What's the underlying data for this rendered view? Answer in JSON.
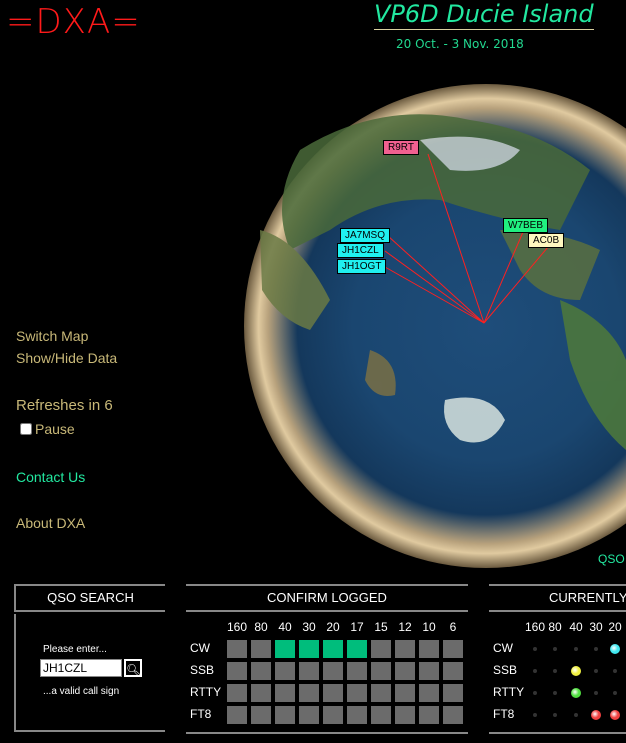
{
  "header": {
    "logo": "=DXA=",
    "title": "VP6D Ducie Island",
    "dates": "20 Oct. - 3 Nov. 2018"
  },
  "sidebar": {
    "switch_map": "Switch Map",
    "show_hide": "Show/Hide Data",
    "refresh": "Refreshes in 6",
    "pause": "Pause",
    "pause_checked": false,
    "contact": "Contact Us",
    "about": "About DXA"
  },
  "map": {
    "corner_text": "QSO",
    "spots": [
      {
        "call": "R9RT",
        "color": "#f06090"
      },
      {
        "call": "W7BEB",
        "color": "#20f080"
      },
      {
        "call": "AC0B",
        "color": "#fff8c0"
      },
      {
        "call": "JA7MSQ",
        "color": "#20f0f0"
      },
      {
        "call": "JH1CZL",
        "color": "#20f0f0"
      },
      {
        "call": "JH1OGT",
        "color": "#20f0f0"
      }
    ]
  },
  "search": {
    "title": "QSO SEARCH",
    "prompt": "Please enter...",
    "value": "JH1CZL",
    "hint": "...a valid call sign"
  },
  "confirm": {
    "title": "CONFIRM  LOGGED",
    "bands": [
      "160",
      "80",
      "40",
      "30",
      "20",
      "17",
      "15",
      "12",
      "10",
      "6"
    ],
    "modes": [
      "CW",
      "SSB",
      "RTTY",
      "FT8"
    ],
    "logged": [
      [
        0,
        0,
        1,
        1,
        1,
        1,
        0,
        0,
        0,
        0
      ],
      [
        0,
        0,
        0,
        0,
        0,
        0,
        0,
        0,
        0,
        0
      ],
      [
        0,
        0,
        0,
        0,
        0,
        0,
        0,
        0,
        0,
        0
      ],
      [
        0,
        0,
        0,
        0,
        0,
        0,
        0,
        0,
        0,
        0
      ]
    ]
  },
  "currently": {
    "title": "CURRENTLY",
    "bands": [
      "160",
      "80",
      "40",
      "30",
      "20"
    ],
    "modes": [
      "CW",
      "SSB",
      "RTTY",
      "FT8"
    ],
    "active": [
      [
        null,
        null,
        null,
        null,
        "#40e8f0"
      ],
      [
        null,
        null,
        "#f0f040",
        null,
        null
      ],
      [
        null,
        null,
        "#50e040",
        null,
        null
      ],
      [
        null,
        null,
        null,
        "#f04040",
        "#f04040"
      ]
    ]
  }
}
